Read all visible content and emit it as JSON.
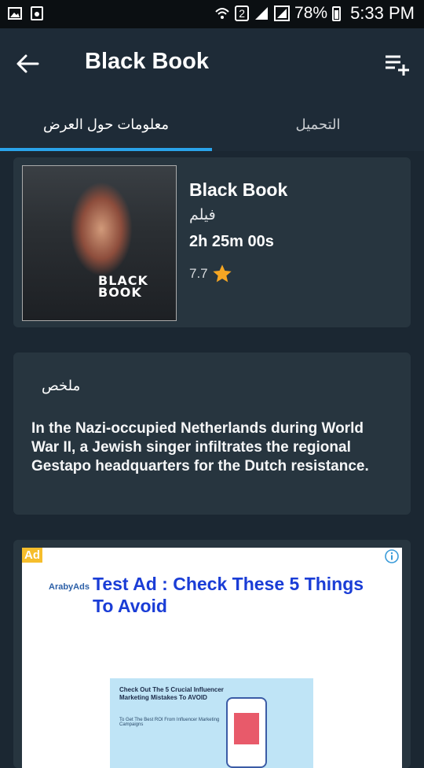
{
  "status_bar": {
    "battery_percent": "78%",
    "time": "5:33 PM",
    "sim_label": "2"
  },
  "app_bar": {
    "title": "Black Book"
  },
  "tabs": [
    {
      "label": "معلومات حول العرض",
      "active": true
    },
    {
      "label": "التحميل",
      "active": false
    }
  ],
  "movie": {
    "title": "Black Book",
    "type": "فيلم",
    "duration": "2h 25m 00s",
    "rating": "7.7",
    "poster_title": "BLACK BOOK"
  },
  "summary": {
    "label": "ملخص",
    "text": "In the Nazi-occupied Netherlands during World War II, a Jewish singer infiltrates the regional Gestapo headquarters for the Dutch resistance."
  },
  "ad": {
    "badge": "Ad",
    "brand": "ArabyAds",
    "headline": "Test Ad : Check These 5 Things To Avoid",
    "image_heading": "Check Out The 5 Crucial Influencer Marketing Mistakes To AVOID",
    "image_sub": "To Get The Best ROI From Influencer Marketing Campaigns"
  },
  "colors": {
    "background": "#1b2732",
    "card": "#27353f",
    "accent": "#2aa3ea",
    "star": "#f5a623",
    "ad_headline": "#1a3dd6"
  }
}
